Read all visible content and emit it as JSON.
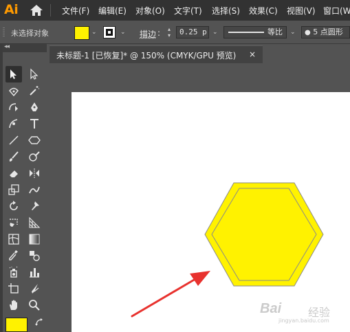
{
  "app": {
    "logo_text": "Ai"
  },
  "menu": [
    "文件(F)",
    "编辑(E)",
    "对象(O)",
    "文字(T)",
    "选择(S)",
    "效果(C)",
    "视图(V)",
    "窗口(W)"
  ],
  "control_bar": {
    "selection_status": "未选择对象",
    "fill_color": "#fff200",
    "stroke_label": "描边",
    "stroke_weight": "0.25 p",
    "stroke_profile": "等比",
    "brush_label": "5 点圆形"
  },
  "document_tab": {
    "title": "未标题-1 [已恢复]* @ 150% (CMYK/GPU 预览)",
    "close_glyph": "×"
  },
  "toolbox": {
    "collapse_glyph": "◂◂",
    "tools": [
      "selection-tool",
      "direct-selection-tool",
      "magic-wand-tool",
      "lasso-tool",
      "pen-tool",
      "curvature-tool",
      "type-tool",
      "line-segment-tool",
      "polygon-tool",
      "paintbrush-tool",
      "shaper-tool",
      "eraser-tool",
      "reflect-tool",
      "scale-tool",
      "warp-tool",
      "rotate-tool",
      "puppet-warp-tool",
      "free-transform-tool",
      "perspective-grid-tool",
      "mesh-tool",
      "gradient-tool",
      "eyedropper-tool",
      "blend-tool",
      "symbol-sprayer-tool",
      "column-graph-tool",
      "artboard-tool",
      "slice-tool",
      "hand-tool",
      "zoom-tool"
    ],
    "fill_color": "#fff200"
  },
  "canvas": {
    "shape": "hexagon",
    "shape_fill": "#fff200",
    "shape_stroke": "#8a8a8a",
    "arrow_color": "#e8322e"
  },
  "watermark": {
    "brand": "Bai",
    "brand2": "经验",
    "url": "jingyan.baidu.com"
  }
}
